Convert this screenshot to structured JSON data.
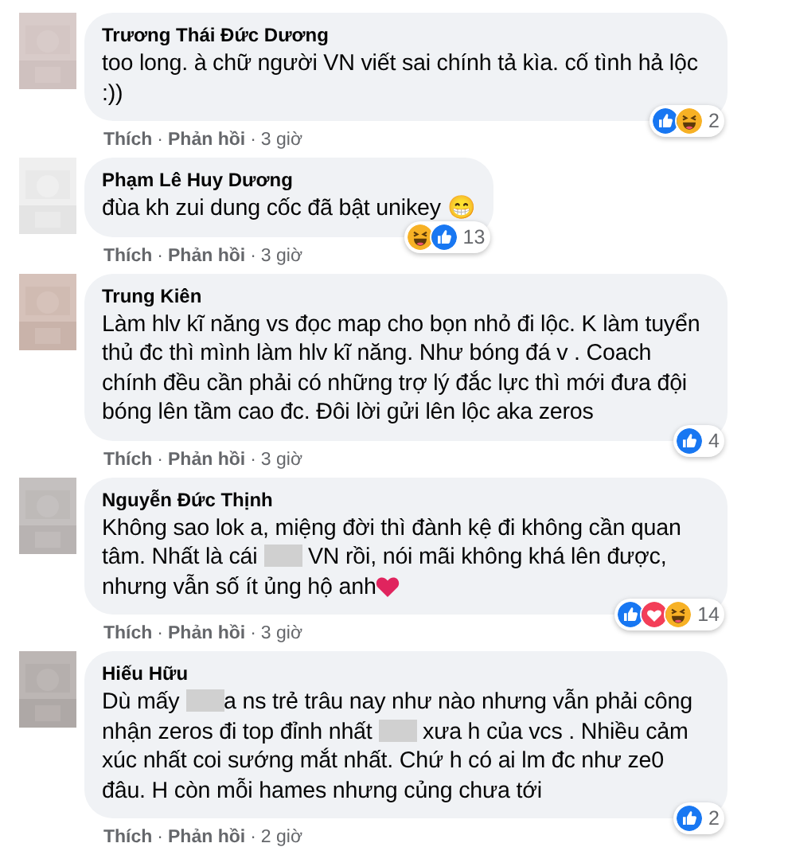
{
  "comments": [
    {
      "author": "Trương Thái Đức Dương",
      "text": [
        {
          "kind": "text",
          "text": "too long. à chữ người VN viết sai chính tả kìa. cố tình hả lộc :))"
        }
      ],
      "reactions": [
        {
          "kind": "like"
        },
        {
          "kind": "haha"
        }
      ],
      "reaction_count": "2",
      "actions": [
        {
          "kind": "link",
          "text": "Thích"
        },
        {
          "kind": "dot",
          "text": "·"
        },
        {
          "kind": "link",
          "text": "Phản hồi"
        },
        {
          "kind": "dot",
          "text": "·"
        },
        {
          "kind": "time",
          "text": "3 giờ"
        }
      ]
    },
    {
      "author": "Phạm Lê Huy Dương",
      "text": [
        {
          "kind": "text",
          "text": "đùa kh zui dung cốc đã bật unikey 😁"
        }
      ],
      "reactions": [
        {
          "kind": "haha"
        },
        {
          "kind": "like"
        }
      ],
      "reaction_count": "13",
      "actions": [
        {
          "kind": "link",
          "text": "Thích"
        },
        {
          "kind": "dot",
          "text": "·"
        },
        {
          "kind": "link",
          "text": "Phản hồi"
        },
        {
          "kind": "dot",
          "text": "·"
        },
        {
          "kind": "time",
          "text": "3 giờ"
        }
      ]
    },
    {
      "author": "Trung Kiên",
      "text": [
        {
          "kind": "text",
          "text": "Làm hlv kĩ năng vs đọc map cho bọn nhỏ đi lộc. K làm tuyển thủ đc thì mình làm hlv kĩ năng. Như bóng đá v . Coach chính đều cần phải có những trợ lý đắc lực thì mới đưa đội bóng lên tầm cao đc. Đôi lời gửi lên lộc aka zeros"
        }
      ],
      "reactions": [
        {
          "kind": "like"
        }
      ],
      "reaction_count": "4",
      "actions": [
        {
          "kind": "link",
          "text": "Thích"
        },
        {
          "kind": "dot",
          "text": "·"
        },
        {
          "kind": "link",
          "text": "Phản hồi"
        },
        {
          "kind": "dot",
          "text": "·"
        },
        {
          "kind": "time",
          "text": "3 giờ"
        }
      ]
    },
    {
      "author": "Nguyễn Đức Thịnh",
      "text": [
        {
          "kind": "text",
          "text": "Không sao lok a, miệng đời thì đành kệ đi không cần quan tâm. Nhất là cái "
        },
        {
          "kind": "blur"
        },
        {
          "kind": "text",
          "text": " VN rồi, nói mãi không khá lên được, nhưng vẫn số ít ủng hộ anh"
        },
        {
          "kind": "heart"
        }
      ],
      "reactions": [
        {
          "kind": "like"
        },
        {
          "kind": "love"
        },
        {
          "kind": "haha"
        }
      ],
      "reaction_count": "14",
      "actions": [
        {
          "kind": "link",
          "text": "Thích"
        },
        {
          "kind": "dot",
          "text": "·"
        },
        {
          "kind": "link",
          "text": "Phản hồi"
        },
        {
          "kind": "dot",
          "text": "·"
        },
        {
          "kind": "time",
          "text": "3 giờ"
        }
      ]
    },
    {
      "author": "Hiếu Hữu",
      "text": [
        {
          "kind": "text",
          "text": "Dù mấy "
        },
        {
          "kind": "blur"
        },
        {
          "kind": "text",
          "text": "a ns trẻ trâu nay như nào nhưng vẫn phải công nhận zeros đi top đỉnh nhất "
        },
        {
          "kind": "blur"
        },
        {
          "kind": "text",
          "text": " xưa h của vcs . Nhiều cảm xúc nhất coi sướng mắt nhất. Chứ h có ai lm đc như ze0 đâu. H còn mỗi hames nhưng củng chưa tới"
        }
      ],
      "reactions": [
        {
          "kind": "like"
        }
      ],
      "reaction_count": "2",
      "actions": [
        {
          "kind": "link",
          "text": "Thích"
        },
        {
          "kind": "dot",
          "text": "·"
        },
        {
          "kind": "link",
          "text": "Phản hồi"
        },
        {
          "kind": "dot",
          "text": "·"
        },
        {
          "kind": "time",
          "text": "2 giờ"
        }
      ]
    }
  ]
}
